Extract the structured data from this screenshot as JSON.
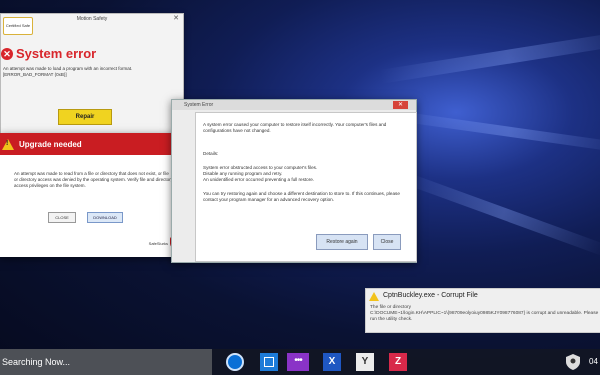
{
  "motion_safety": {
    "title": "Motion Safety",
    "badge": "Certified Safe",
    "heading": "System error",
    "line1": "An attempt was made to load a program with an incorrect format.",
    "line2": "[ERROR_BAD_FORMAT (0xB)]",
    "repair_label": "Repair"
  },
  "upgrade": {
    "heading": "Upgrade needed",
    "text": "An attempt was made to read from a file or directory that does not exist, or file or directory access was denied by the operating system. Verify file and directory access privileges on the file system.",
    "close_label": "CLOSE",
    "download_label": "DOWNLOAD",
    "brand": "SafeSlurks"
  },
  "system_error": {
    "title": "System Error",
    "p1": "A system error caused your computer to restore itself incorrectly. Your computer's files and configurations have not changed.",
    "details_label": "Details:",
    "d1": "System error obstructed access to your computer's files.",
    "d2": "Disable any running program and retry.",
    "d3": "An unidentified error occurred preventing a full restore.",
    "p2": "You can try restoring again and choose a different destination to store to. If this continues, please contact your program manager for an advanced recovery option.",
    "restore_label": "Restore again",
    "close_label": "Close"
  },
  "toast": {
    "title": "CptnBuckley.exe - Corrupt File",
    "line1": "The file or directory",
    "line2": "C:\\DOCUME~1\\login.KH\\APPLIC~1\\{98709eolyoiuy0985KJY098776087} is corrupt and unreadable. Please run the utility check."
  },
  "taskbar": {
    "search_text": "Searching Now...",
    "icons": [
      "clock-icon",
      "window-icon",
      "dots-icon",
      "x-app-icon",
      "y-app-icon",
      "z-app-icon"
    ],
    "clock": "04"
  }
}
